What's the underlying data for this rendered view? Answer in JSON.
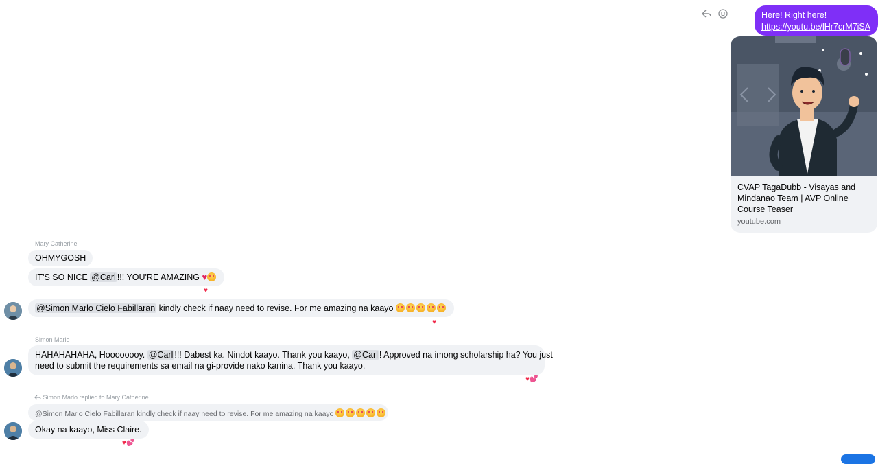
{
  "outgoing": {
    "text": "Here! Right here!",
    "link": "https://youtu.be/lHr7crM7iSA",
    "icons": [
      "reply-icon",
      "react-smile-icon"
    ]
  },
  "preview": {
    "title": "CVAP TagaDubb - Visayas and Mindanao Team | AVP Online Course Teaser",
    "domain": "youtube.com"
  },
  "messages": {
    "mary_name": "Mary Catherine",
    "m1": "OHMYGOSH",
    "m2_pre": "IT'S SO NICE ",
    "m2_mention": "@Carl",
    "m2_post": "!!! YOU'RE AMAZING ",
    "m3_mention": "@Simon Marlo Cielo Fabillaran",
    "m3_post": " kindly check if naay need to revise. For me amazing na kaayo ",
    "simon_name": "Simon Marlo",
    "m4_a": "HAHAHAHAHA, Hoooooooy. ",
    "m4_mention1": "@Carl",
    "m4_b": "!!! Dabest ka. Nindot kaayo. Thank you kaayo, ",
    "m4_mention2": "@Carl",
    "m4_c": "! Approved na imong scholarship ha? You just",
    "m4_line2": "need to submit the requirements sa email na gi-provide nako kanina. Thank you kaayo.",
    "reply_label": "Simon Marlo replied to Mary Catherine",
    "reply_quote": "@Simon Marlo Cielo Fabillaran kindly check if naay need to revise. For me amazing na kaayo ",
    "m5": "Okay na kaayo, Miss Claire."
  },
  "colors": {
    "outgoing_bubble": "#7f2ff7",
    "incoming_bubble": "#f0f2f5",
    "reaction_heart": "#f02849"
  }
}
